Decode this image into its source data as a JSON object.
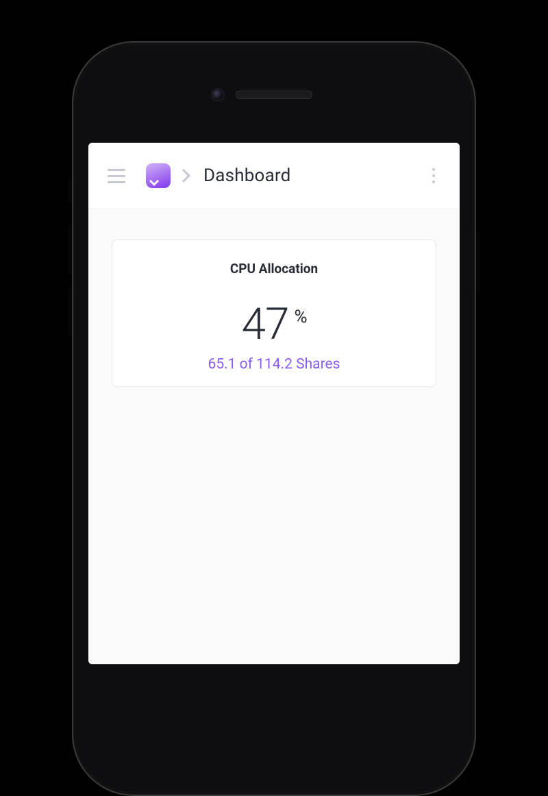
{
  "header": {
    "breadcrumb_title": "Dashboard"
  },
  "card": {
    "title": "CPU Allocation",
    "value": "47",
    "unit": "%",
    "subline": "65.1 of 114.2 Shares",
    "used": 65.1,
    "total": 114.2,
    "share_label": "Shares"
  },
  "colors": {
    "accent": "#8b5cf6"
  }
}
